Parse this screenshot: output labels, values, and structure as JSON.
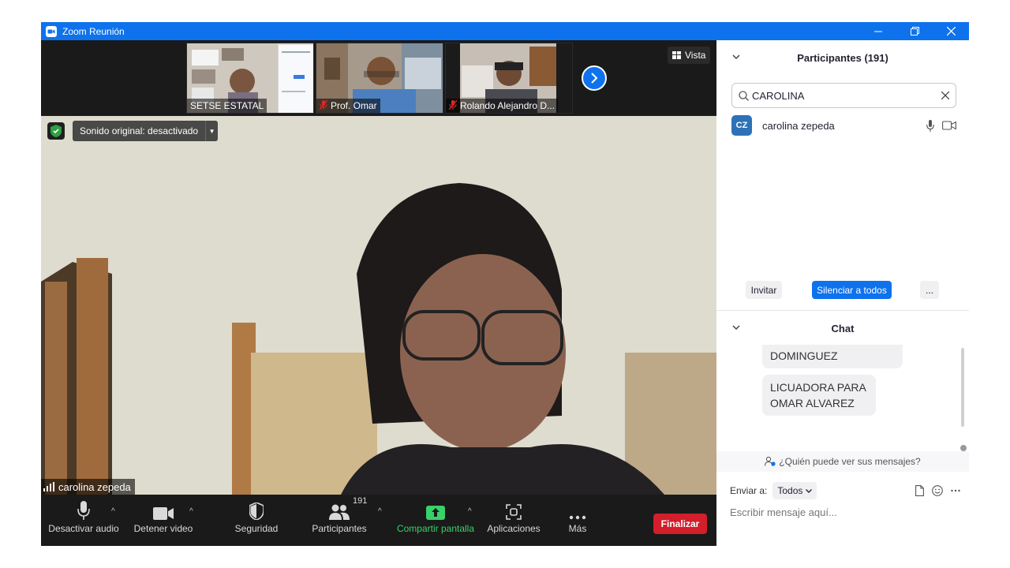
{
  "window": {
    "title": "Zoom Reunión",
    "icon": "zoom-icon"
  },
  "thumbnails": [
    {
      "name": "SETSE ESTATAL",
      "muted": false
    },
    {
      "name": "Prof. Omar",
      "muted": true
    },
    {
      "name": "Rolando Alejandro D...",
      "muted": true
    }
  ],
  "view_button": {
    "label": "Vista"
  },
  "main_video": {
    "sound_label": "Sonido original: desactivado",
    "speaker_name": "carolina zepeda"
  },
  "toolbar": {
    "audio": "Desactivar audio",
    "video": "Detener video",
    "security": "Seguridad",
    "participants": "Participantes",
    "participants_count": "191",
    "share": "Compartir pantalla",
    "apps": "Aplicaciones",
    "more": "Más",
    "end": "Finalizar"
  },
  "participants_panel": {
    "title": "Participantes (191)",
    "search_value": "CAROLINA",
    "results": [
      {
        "initials": "CZ",
        "name": "carolina zepeda"
      }
    ],
    "buttons": {
      "invite": "Invitar",
      "mute_all": "Silenciar a todos",
      "more": "..."
    }
  },
  "chat_panel": {
    "title": "Chat",
    "messages": [
      {
        "text": "DOMINGUEZ"
      },
      {
        "text": "LICUADORA PARA OMAR ALVAREZ"
      }
    ],
    "who_can_see": "¿Quién puede ver sus mensajes?",
    "send_to_label": "Enviar a:",
    "send_to_value": "Todos",
    "placeholder": "Escribir mensaje aquí..."
  },
  "colors": {
    "accent": "#0e72ed",
    "end": "#d31e2b",
    "share": "#38d16a",
    "toolbar": "#1a1a1a"
  }
}
